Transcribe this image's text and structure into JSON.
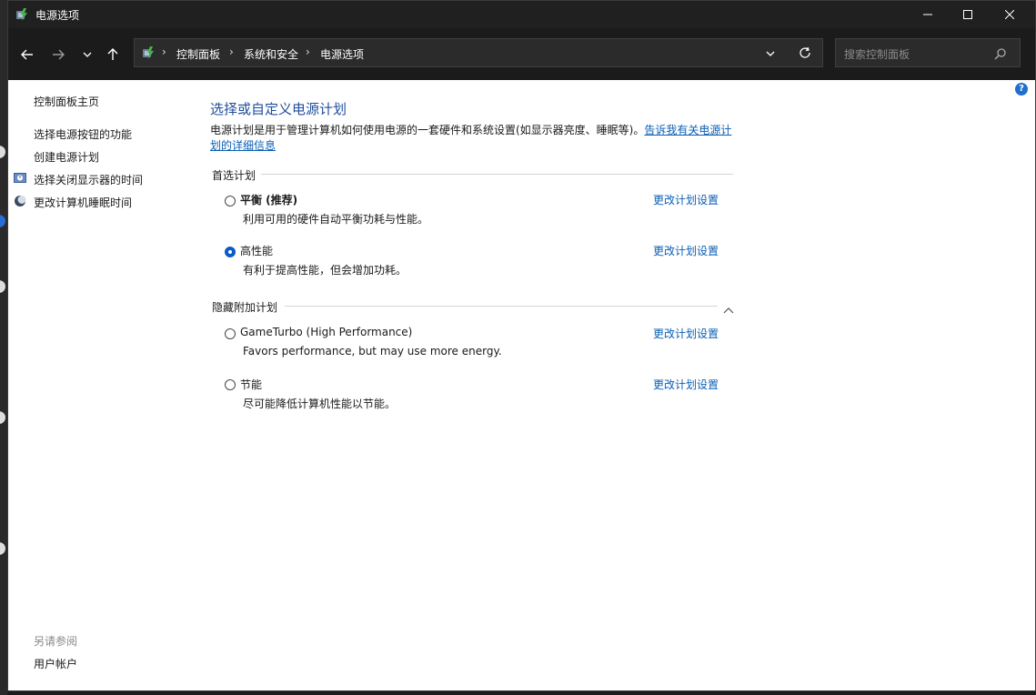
{
  "window": {
    "title": "电源选项"
  },
  "nav": {
    "breadcrumbs": [
      "控制面板",
      "系统和安全",
      "电源选项"
    ],
    "search_placeholder": "搜索控制面板"
  },
  "sidebar": {
    "home": "控制面板主页",
    "links": [
      "选择电源按钮的功能",
      "创建电源计划",
      "选择关闭显示器的时间",
      "更改计算机睡眠时间"
    ],
    "see_also_title": "另请参阅",
    "see_also_links": [
      "用户帐户"
    ]
  },
  "main": {
    "title": "选择或自定义电源计划",
    "description": "电源计划是用于管理计算机如何使用电源的一套硬件和系统设置(如显示器亮度、睡眠等)。",
    "learn_more": "告诉我有关电源计划的详细信息",
    "preferred_heading": "首选计划",
    "hidden_heading": "隐藏附加计划",
    "change_link": "更改计划设置",
    "preferred_plans": [
      {
        "name": "平衡 (推荐)",
        "desc": "利用可用的硬件自动平衡功耗与性能。",
        "selected": false
      },
      {
        "name": "高性能",
        "desc": "有利于提高性能，但会增加功耗。",
        "selected": true
      }
    ],
    "hidden_plans": [
      {
        "name": "GameTurbo (High Performance)",
        "desc": "Favors performance, but may use more energy.",
        "selected": false
      },
      {
        "name": "节能",
        "desc": "尽可能降低计算机性能以节能。",
        "selected": false
      }
    ]
  },
  "colors": {
    "accent": "#0a5bc7",
    "link": "#0b5fb4",
    "title": "#1e4e9b",
    "chrome": "#1b1b1b"
  }
}
